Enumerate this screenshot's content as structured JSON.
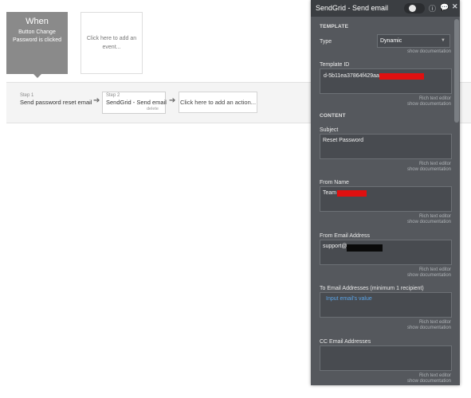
{
  "when_card": {
    "title": "When",
    "subtitle": "Button Change Password is clicked"
  },
  "event_card": {
    "label": "Click here to add an event..."
  },
  "steps": [
    {
      "num": "Step 1",
      "label": "Send password reset email"
    },
    {
      "num": "Step 2",
      "label": "SendGrid - Send email",
      "delete": "delete"
    }
  ],
  "add_action": "Click here to add an action...",
  "panel": {
    "title": "SendGrid - Send email",
    "sections": {
      "template": "TEMPLATE",
      "content": "CONTENT"
    },
    "type": {
      "label": "Type",
      "value": "Dynamic",
      "doc": "show documentation"
    },
    "template_id": {
      "label": "Template ID",
      "value": "d-5b11ea37864f429aa",
      "rte": "Rich text editor",
      "doc": "show documentation"
    },
    "subject": {
      "label": "Subject",
      "value": "Reset Password",
      "rte": "Rich text editor",
      "doc": "show documentation"
    },
    "from_name": {
      "label": "From Name",
      "value": "Team",
      "rte": "Rich text editor",
      "doc": "show documentation"
    },
    "from_email": {
      "label": "From Email Address",
      "value": "support@",
      "rte": "Rich text editor",
      "doc": "show documentation"
    },
    "to_email": {
      "label": "To Email Addresses (minimum 1 recipient)",
      "value": "Input email's value",
      "rte": "Rich text editor",
      "doc": "show documentation"
    },
    "cc_email": {
      "label": "CC Email Addresses",
      "value": "",
      "rte": "Rich text editor",
      "doc": "show documentation"
    }
  },
  "icons": {
    "info": "info-icon",
    "comment": "comment-icon",
    "close": "close-icon",
    "arrow": "arrow-right-icon",
    "caret": "chevron-down-icon"
  }
}
